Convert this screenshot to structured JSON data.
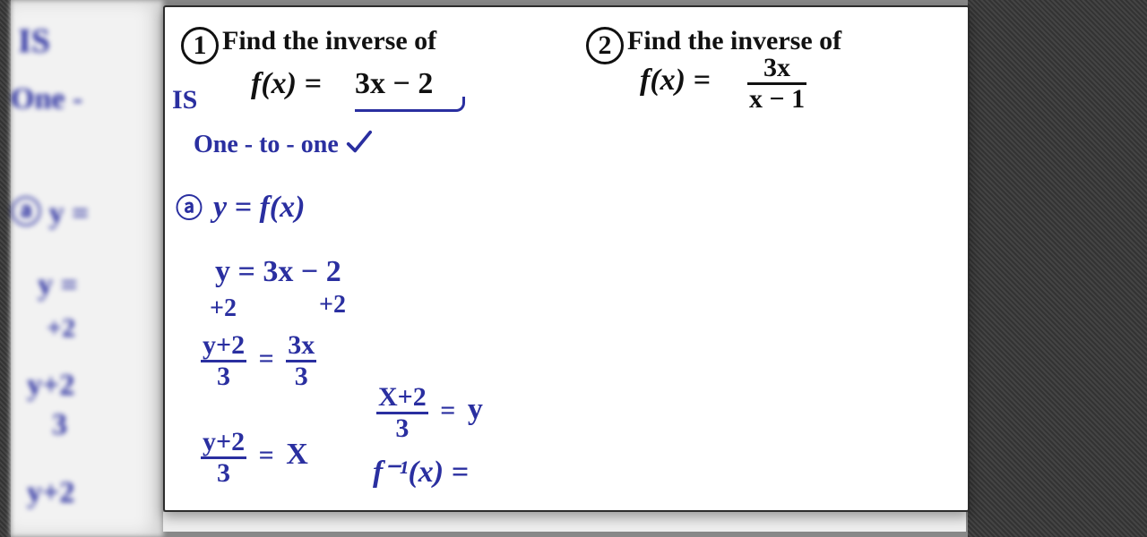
{
  "back_layer": {
    "l1": "IS",
    "l2": "One -",
    "l3": "ⓐ y =",
    "l4": "y =",
    "l5": "+2",
    "l6": "y+2",
    "l7": "3",
    "l8": "y+2"
  },
  "problem1": {
    "number": "1",
    "title": "Find the inverse of",
    "func_lhs": "f(x) =",
    "func_rhs": "3x − 2",
    "note_is": "IS",
    "note_oto": "One - to - one",
    "step_label": "ⓐ",
    "step_a": "y = f(x)",
    "eq1": "y = 3x − 2",
    "plus2_l": "+2",
    "plus2_r": "+2",
    "eq2_lhs_num": "y+2",
    "eq2_lhs_den": "3",
    "eq2_mid": "=",
    "eq2_rhs_num": "3x",
    "eq2_rhs_den": "3",
    "eq3_lhs_num": "y+2",
    "eq3_lhs_den": "3",
    "eq3_mid": "=",
    "eq3_rhs": "X",
    "eq4_lhs_num": "X+2",
    "eq4_lhs_den": "3",
    "eq4_mid": "=",
    "eq4_rhs": "y",
    "finv": "f⁻¹(x) ="
  },
  "problem2": {
    "number": "2",
    "title": "Find the inverse of",
    "func_lhs": "f(x) =",
    "func_rhs_num": "3x",
    "func_rhs_den": "x − 1"
  }
}
